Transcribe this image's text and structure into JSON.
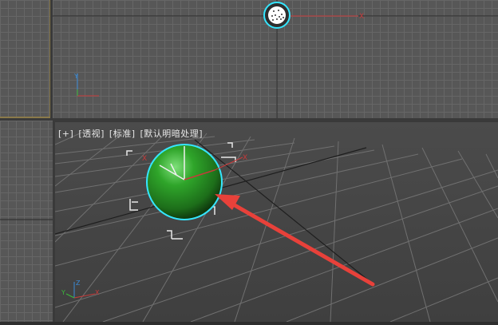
{
  "viewports": {
    "perspective": {
      "menu_plus": "[+]",
      "menu_view": "[透视]",
      "menu_shading": "[标准]",
      "menu_lighting": "[默认明暗处理]"
    },
    "top": {
      "axis_x": "X",
      "axis_y": "Y"
    },
    "gizmo_axes": {
      "x": "X",
      "y": "Y",
      "z": "Z"
    }
  },
  "colors": {
    "sphere": "#2fa52a",
    "selection_outline": "#35e6ff",
    "arrow": "#e8413a",
    "active_viewport_border": "#8a7a4a",
    "grid_line": "#666666"
  },
  "objects": {
    "sphere_icon": "sphere-icon",
    "arrow_icon": "pointer-arrow-icon"
  }
}
